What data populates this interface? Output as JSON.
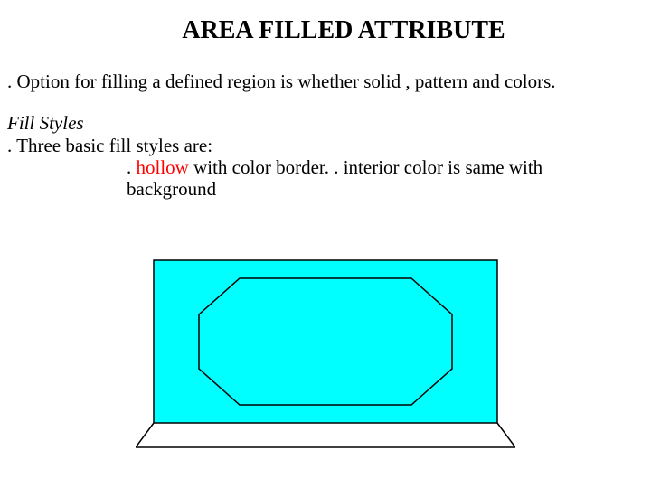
{
  "title": "AREA FILLED ATTRIBUTE",
  "intro": ". Option for filling a defined region is whether solid , pattern and colors.",
  "subhead": "Fill Styles",
  "line1": ". Three basic fill styles are:",
  "bullet_prefix": ". ",
  "hollow_word": "hollow",
  "bullet_rest_a": " with color border. . interior color is same with",
  "bullet_rest_b": "background",
  "colors": {
    "cyan": "#00ffff",
    "black": "#000000",
    "red": "#ff0000",
    "white": "#ffffff"
  }
}
